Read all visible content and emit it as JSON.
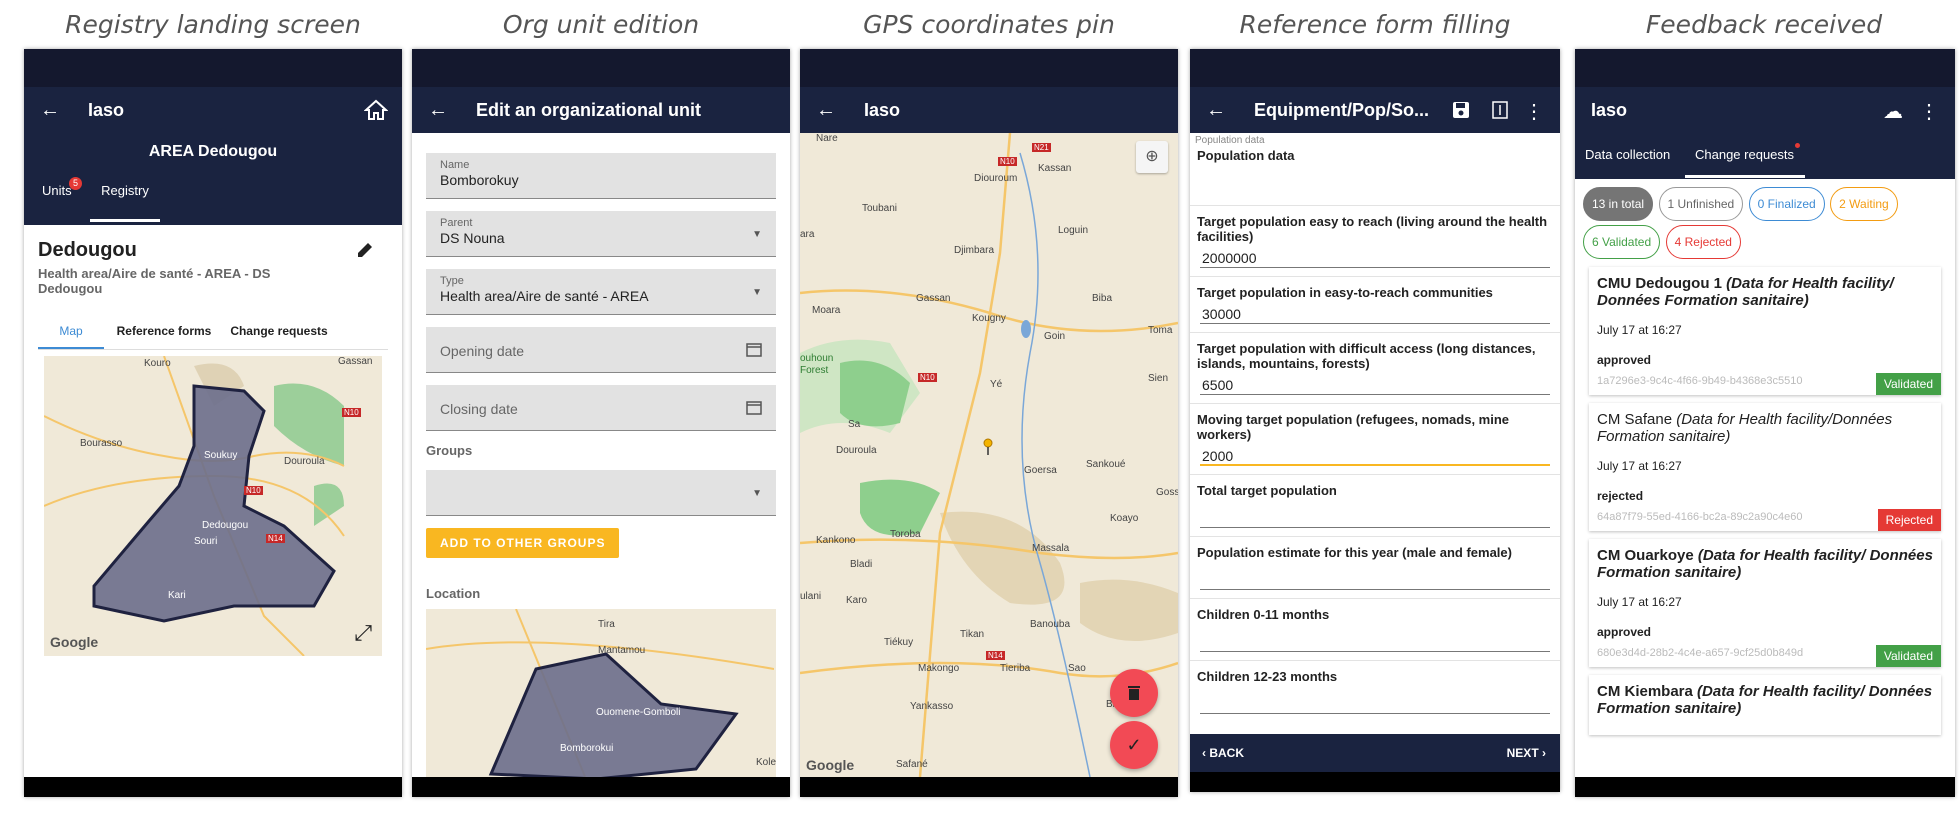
{
  "captions": [
    "Registry landing screen",
    "Org unit edition",
    "GPS coordinates pin",
    "Reference form filling",
    "Feedback received"
  ],
  "colors": {
    "appbar": "#1a2340",
    "accent": "#3d8bd4",
    "fab": "#f24a55",
    "validated": "#43a047",
    "rejected": "#e53935",
    "waiting": "#f39c12",
    "finalized": "#3d8bd4",
    "button": "#f9b721"
  },
  "screen1": {
    "app_title": "Iaso",
    "org_header": "AREA Dedougou",
    "tabs": [
      "Units",
      "Registry"
    ],
    "units_badge": "5",
    "org_name": "Dedougou",
    "org_path": "Health area/Aire de santé - AREA - DS Dedougou",
    "subtabs": [
      "Map",
      "Reference forms",
      "Change requests"
    ],
    "map_labels": [
      "Kouro",
      "Gassan",
      "Bourasso",
      "Soukuy",
      "Douroula",
      "Dedougou",
      "Souri",
      "Kari",
      "N10",
      "N14",
      "N10"
    ],
    "map_brand": "Google"
  },
  "screen2": {
    "title": "Edit an organizational unit",
    "name_label": "Name",
    "name_value": "Bomborokuy",
    "parent_label": "Parent",
    "parent_value": "DS Nouna",
    "type_label": "Type",
    "type_value": "Health area/Aire de santé - AREA",
    "opening_placeholder": "Opening date",
    "closing_placeholder": "Closing date",
    "groups_label": "Groups",
    "add_groups_button": "ADD TO OTHER GROUPS",
    "location_label": "Location",
    "map_labels": [
      "Tira",
      "Mantamou",
      "Ouomene-Gomboli",
      "Bomborokui",
      "Kole"
    ]
  },
  "screen3": {
    "app_title": "Iaso",
    "map_labels": [
      "Nare",
      "Kassan",
      "Diouroum",
      "Toubani",
      "Loguin",
      "ara",
      "Djimbara",
      "Moara",
      "Gassan",
      "Kougny",
      "Biba",
      "Goin",
      "Toma",
      "ouhoun",
      "Forest",
      "Sien",
      "Sa",
      "Yé",
      "Douroula",
      "Goersa",
      "Sankoué",
      "Goss",
      "Koayo",
      "Kankono",
      "Toroba",
      "Massala",
      "Bladi",
      "ulani",
      "Karo",
      "Banouba",
      "Tiékuy",
      "Tikan",
      "Makongo",
      "Tieriba",
      "Sao",
      "Yankasso",
      "Bi",
      "Safané"
    ],
    "road_labels": [
      "N10",
      "N21",
      "N10",
      "N14"
    ],
    "map_brand": "Google"
  },
  "screen4": {
    "title": "Equipment/Pop/So...",
    "section_small": "Population data",
    "section_title": "Population data",
    "fields": [
      {
        "label": "Target population easy to reach (living around the health facilities)",
        "value": "2000000"
      },
      {
        "label": "Target population in easy-to-reach communities",
        "value": "30000"
      },
      {
        "label": "Target population with difficult access (long distances, islands, mountains, forests)",
        "value": "6500"
      },
      {
        "label": "Moving target population (refugees, nomads, mine workers)",
        "value": "2000"
      },
      {
        "label": "Total target population",
        "value": ""
      },
      {
        "label": "Population estimate for this year (male and female)",
        "value": ""
      },
      {
        "label": "Children 0-11 months",
        "value": ""
      },
      {
        "label": "Children 12-23 months",
        "value": ""
      }
    ],
    "back_label": "BACK",
    "next_label": "NEXT"
  },
  "screen5": {
    "app_title": "Iaso",
    "tabs": [
      "Data collection",
      "Change requests"
    ],
    "chips": [
      {
        "label": "13 in total",
        "style": "total"
      },
      {
        "label": "1 Unfinished",
        "style": "unfinished"
      },
      {
        "label": "0 Finalized",
        "style": "finalized"
      },
      {
        "label": "2 Waiting",
        "style": "waiting"
      },
      {
        "label": "6 Validated",
        "style": "validated"
      },
      {
        "label": "4 Rejected",
        "style": "rejected"
      }
    ],
    "cards": [
      {
        "name": "CMU Dedougou 1",
        "form": "(Data for Health facility/ Données Formation sanitaire)",
        "date": "July 17 at 16:27",
        "status": "approved",
        "uuid": "1a7296e3-9c4c-4f66-9b49-b4368e3c5510",
        "badge": "Validated"
      },
      {
        "name": "CM Safane",
        "form": "(Data for Health facility/Données Formation sanitaire)",
        "date": "July 17 at 16:27",
        "status": "rejected",
        "uuid": "64a87f79-55ed-4166-bc2a-89c2a90c4e60",
        "badge": "Rejected"
      },
      {
        "name": "CM Ouarkoye",
        "form": "(Data for Health facility/ Données Formation sanitaire)",
        "date": "July 17 at 16:27",
        "status": "approved",
        "uuid": "680e3d4d-28b2-4c4e-a657-9cf25d0b849d",
        "badge": "Validated"
      },
      {
        "name": "CM Kiembara",
        "form": "(Data for Health facility/ Données Formation sanitaire)",
        "date": "",
        "status": "",
        "uuid": "",
        "badge": ""
      }
    ]
  }
}
